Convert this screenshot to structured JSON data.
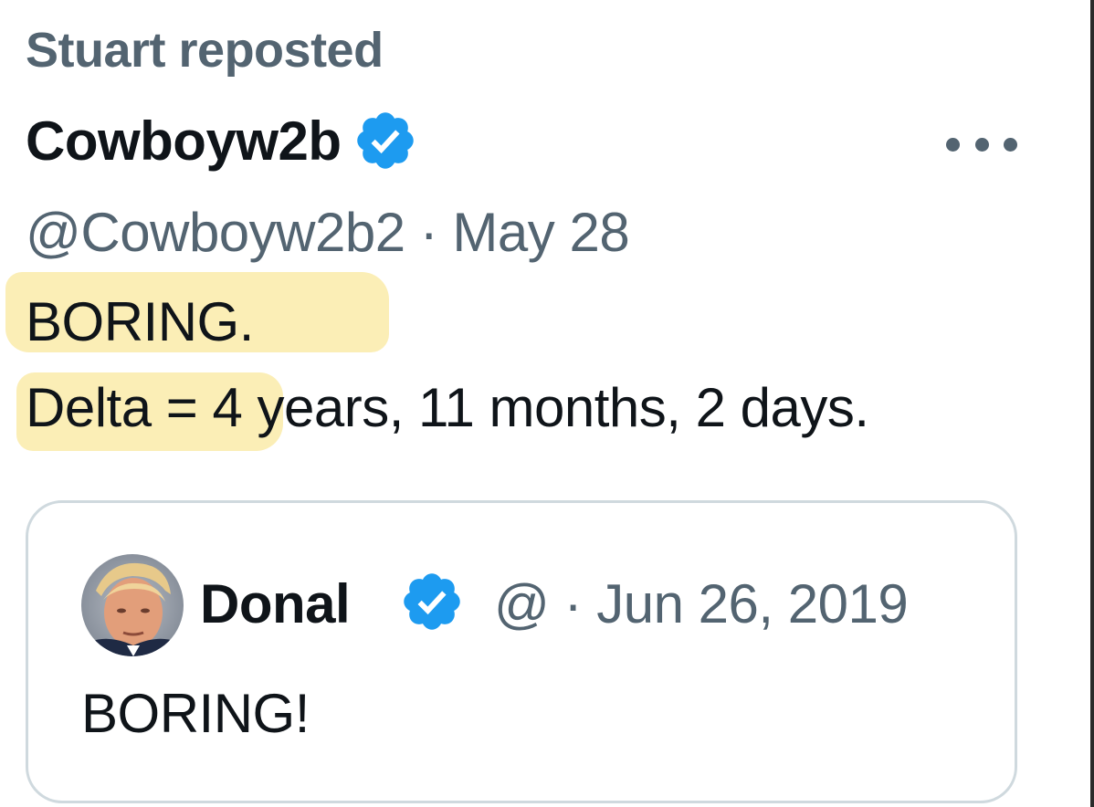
{
  "repost": {
    "text": "Stuart reposted"
  },
  "post": {
    "display_name": "Cowboyw2b",
    "meta": "@Cowboyw2b2 · May 28",
    "verified_icon": "verified-badge-icon",
    "more_icon": "more-options-icon",
    "body": {
      "line1": "BORING.",
      "line2": "Delta = 4 years, 11 months, 2 days."
    }
  },
  "quoted_post": {
    "display_name": "Donal",
    "meta": "@ · Jun 26, 2019",
    "verified_icon": "verified-badge-icon",
    "avatar_icon": "avatar",
    "text": "BORING!"
  },
  "colors": {
    "verified": "#1d9bf0",
    "secondary_text": "#536471",
    "primary_text": "#0f1419",
    "highlight": "#fbeeb6",
    "card_border": "#cfd9de"
  }
}
